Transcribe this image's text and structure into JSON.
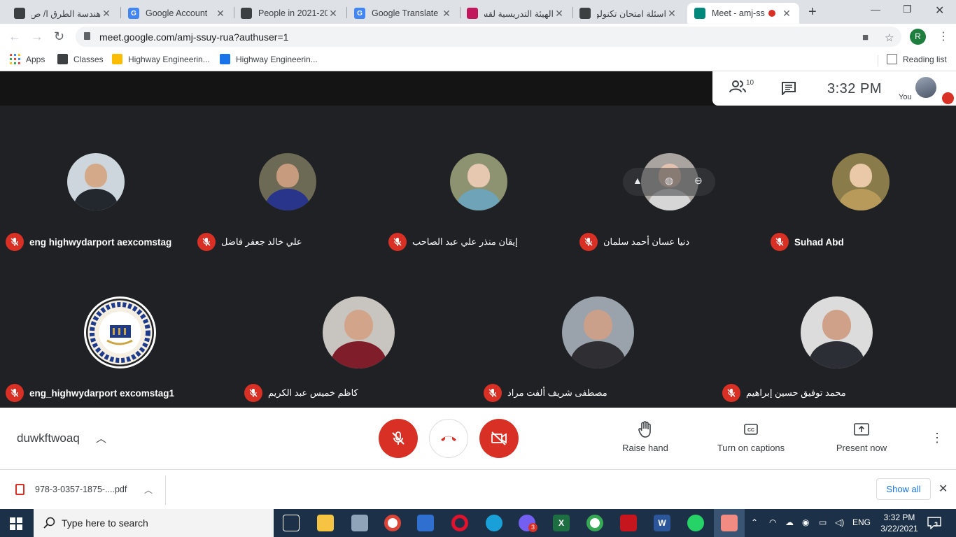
{
  "browser": {
    "tabs": [
      {
        "title": "هندسة الطرق ا/ ص",
        "favicon": "classroom-icon",
        "color": "#3c4043"
      },
      {
        "title": "Google Account",
        "favicon": "google-icon",
        "color": "#4285f4"
      },
      {
        "title": "People in 2021-20",
        "favicon": "classroom-icon",
        "color": "#3c4043"
      },
      {
        "title": "Google Translate",
        "favicon": "translate-icon",
        "color": "#4285f4"
      },
      {
        "title": "الهيئة التدريسية لقسم",
        "favicon": "site-icon",
        "color": "#c2185b"
      },
      {
        "title": "اسئلة امتحان تكنولو",
        "favicon": "classroom-icon",
        "color": "#3c4043"
      },
      {
        "title": "Meet - amj-ss",
        "favicon": "meet-icon",
        "color": "#00897b"
      }
    ],
    "url": "meet.google.com/amj-ssuy-rua?authuser=1",
    "profile_initial": "R",
    "bookmarks": [
      {
        "label": "Apps",
        "color": "#ea4335"
      },
      {
        "label": "Classes",
        "color": "#3c4043"
      },
      {
        "label": "Highway Engineerin...",
        "color": "#fbbc04"
      },
      {
        "label": "Highway Engineerin...",
        "color": "#1a73e8"
      }
    ],
    "reading_list": "Reading list"
  },
  "meet": {
    "participant_count": "10",
    "time": "3:32  PM",
    "you_label": "You",
    "meeting_code": "duwkftwoaq",
    "participants_row1": [
      {
        "name": "eng highwydarport aexcomstag",
        "av_bg": "#cdd6dc",
        "av_face": "#d4a98a",
        "av_body": "#23282e",
        "rtl": false
      },
      {
        "name": "علي خالد جعفر فاضل",
        "av_bg": "#6c6a55",
        "av_face": "#c69b7e",
        "av_body": "#28358a",
        "rtl": true
      },
      {
        "name": "إيقان منذر علي عبد الصاحب",
        "av_bg": "#8d9270",
        "av_face": "#e6c7b0",
        "av_body": "#6fa3b7",
        "rtl": true
      },
      {
        "name": "دنيا عسان أحمد سلمان",
        "av_bg": "#a9a4a0",
        "av_face": "#e3c3b0",
        "av_body": "#d6d6d6",
        "rtl": true
      },
      {
        "name": "Suhad Abd",
        "av_bg": "#8a7b4a",
        "av_face": "#e9c9a8",
        "av_body": "#b89a5a",
        "rtl": false
      }
    ],
    "participants_row2": [
      {
        "name": "eng_highwydarport excomstag1",
        "av_bg": "#f4efe0",
        "av_face": "#1e3a8a",
        "av_body": "#caa541",
        "rtl": false,
        "logo": true
      },
      {
        "name": "كاظم خميس عبد الكريم",
        "av_bg": "#c8c4c0",
        "av_face": "#d2a58a",
        "av_body": "#7f1d2a",
        "rtl": true
      },
      {
        "name": "مصطفى شريف ألفت مراد",
        "av_bg": "#9aa3ab",
        "av_face": "#caa08b",
        "av_body": "#2e2e33",
        "rtl": true
      },
      {
        "name": "محمد توفيق حسين إبراهيم",
        "av_bg": "#dcdcdc",
        "av_face": "#d0a189",
        "av_body": "#2b2e34",
        "rtl": true
      }
    ],
    "actions": {
      "raise_hand": "Raise hand",
      "captions": "Turn on captions",
      "present": "Present now"
    }
  },
  "downloads": {
    "file_name": "978-3-0357-1875-....pdf",
    "show_all": "Show all"
  },
  "taskbar": {
    "search_placeholder": "Type here to search",
    "language": "ENG",
    "time": "3:32 PM",
    "date": "3/22/2021",
    "notifications": "3",
    "viber_badge": "3"
  },
  "colors": {
    "mute_red": "#d93025",
    "meet_dark": "#202124",
    "taskbar": "#1c3147"
  }
}
